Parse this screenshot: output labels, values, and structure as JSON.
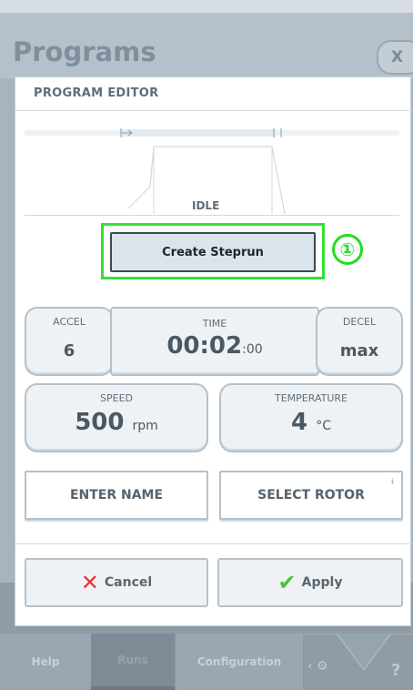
{
  "page": {
    "title": "Programs",
    "close_label": "X"
  },
  "dialog": {
    "title": "PROGRAM EDITOR",
    "status": "IDLE",
    "create_steprun_label": "Create Steprun",
    "callout_number": "①"
  },
  "params": {
    "accel": {
      "label": "ACCEL",
      "value": "6"
    },
    "time": {
      "label": "TIME",
      "value": "00:02",
      "seconds": ":00"
    },
    "decel": {
      "label": "DECEL",
      "value": "max"
    },
    "speed": {
      "label": "SPEED",
      "value": "500",
      "unit": "rpm"
    },
    "temperature": {
      "label": "TEMPERATURE",
      "value": "4",
      "unit": "°C"
    }
  },
  "buttons": {
    "enter_name": "ENTER NAME",
    "select_rotor": "SELECT ROTOR",
    "select_rotor_info": "i",
    "cancel": "Cancel",
    "apply": "Apply"
  },
  "nav": {
    "tabs": [
      {
        "label": "Help"
      },
      {
        "label": "Runs"
      },
      {
        "label": "Configuration"
      }
    ],
    "gear_icon": "gear-icon",
    "help_label": "?"
  },
  "colors": {
    "highlight": "#33e033",
    "cancel_icon": "#e63636",
    "apply_icon": "#4cc23a"
  }
}
